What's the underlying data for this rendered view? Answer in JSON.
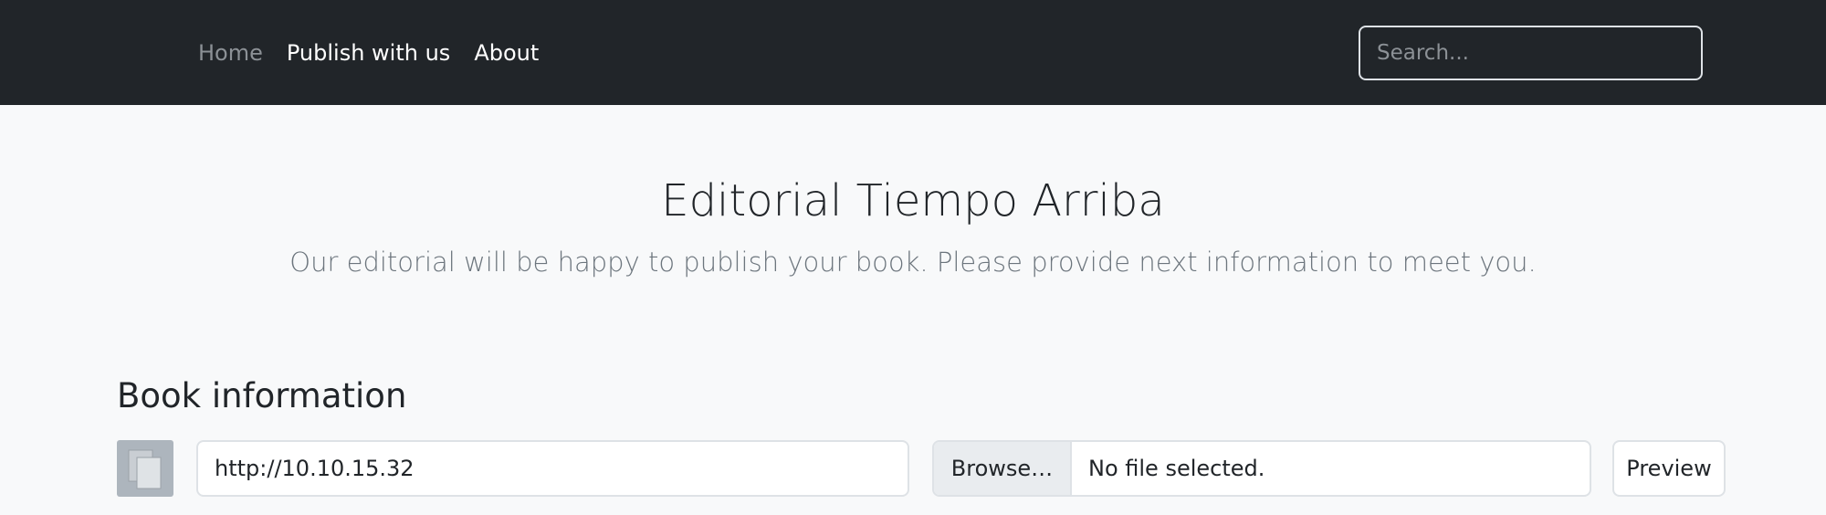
{
  "nav": {
    "items": [
      {
        "label": "Home",
        "active": true
      },
      {
        "label": "Publish with us",
        "active": false
      },
      {
        "label": "About",
        "active": false
      }
    ],
    "search_placeholder": "Search..."
  },
  "header": {
    "title": "Editorial Tiempo Arriba",
    "subtitle": "Our editorial will be happy to publish your book. Please provide next information to meet you."
  },
  "book_info": {
    "section_title": "Book information",
    "cover_icon": "files-icon",
    "cover_url_value": "http://10.10.15.32",
    "browse_label": "Browse…",
    "file_status": "No file selected.",
    "preview_label": "Preview"
  },
  "colors": {
    "navbar_bg": "#212529",
    "page_bg": "#f8f9fa",
    "muted_text": "#6c757d"
  }
}
